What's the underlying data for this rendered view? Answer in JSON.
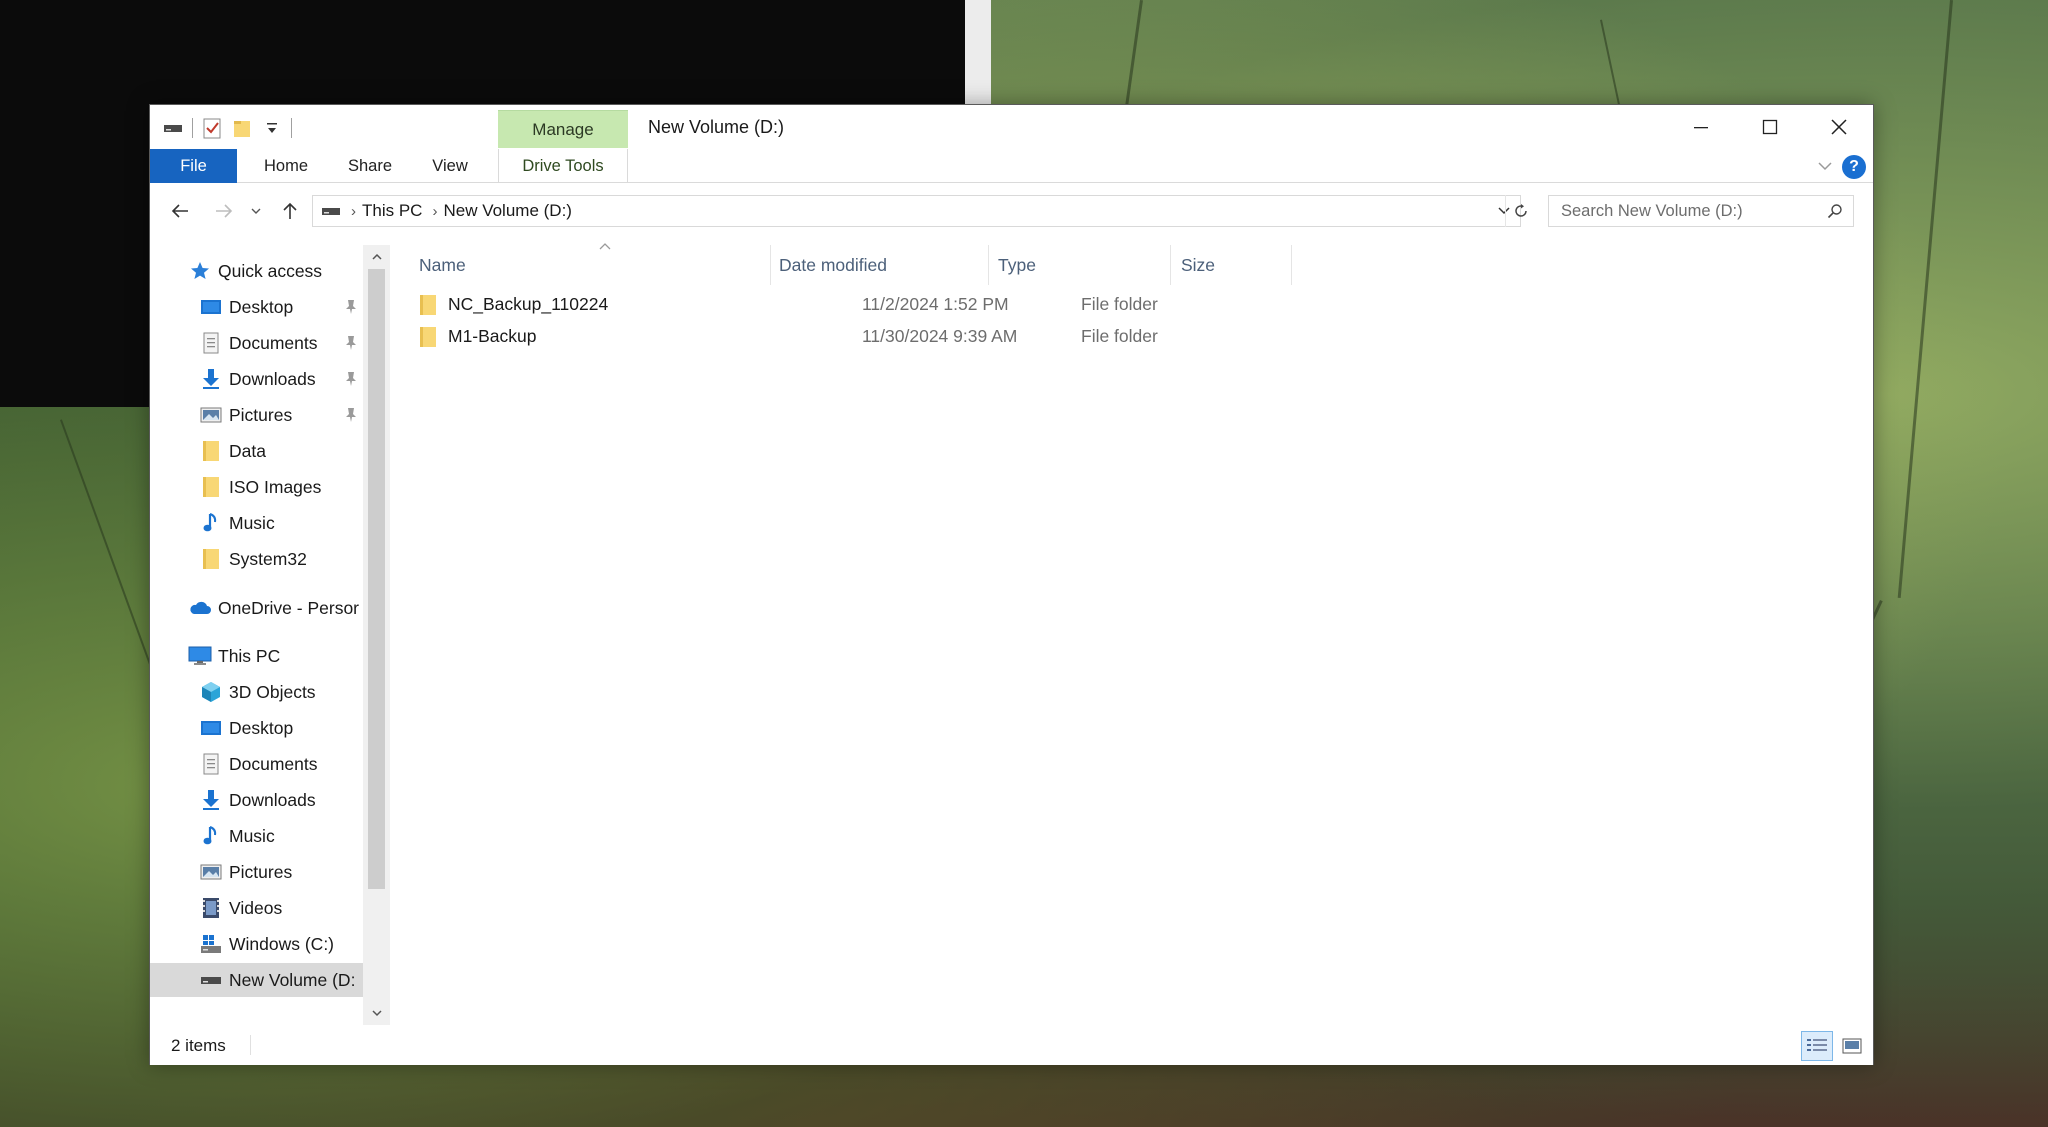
{
  "window": {
    "title": "New Volume (D:)",
    "context_tab_group": "Manage",
    "ribbon_tabs": [
      "File",
      "Home",
      "Share",
      "View",
      "Drive Tools"
    ],
    "help_label": "?"
  },
  "address": {
    "breadcrumbs": [
      "This PC",
      "New Volume (D:)"
    ],
    "search_placeholder": "Search New Volume (D:)"
  },
  "nav_pane": {
    "quick_access": {
      "label": "Quick access",
      "items": [
        {
          "label": "Desktop",
          "icon": "desktop-icon",
          "pinned": true
        },
        {
          "label": "Documents",
          "icon": "documents-icon",
          "pinned": true
        },
        {
          "label": "Downloads",
          "icon": "downloads-icon",
          "pinned": true
        },
        {
          "label": "Pictures",
          "icon": "pictures-icon",
          "pinned": true
        },
        {
          "label": "Data",
          "icon": "folder-icon",
          "pinned": false
        },
        {
          "label": "ISO Images",
          "icon": "folder-icon",
          "pinned": false
        },
        {
          "label": "Music",
          "icon": "music-icon",
          "pinned": false
        },
        {
          "label": "System32",
          "icon": "folder-icon",
          "pinned": false
        }
      ]
    },
    "onedrive": {
      "label": "OneDrive - Persor"
    },
    "this_pc": {
      "label": "This PC",
      "items": [
        {
          "label": "3D Objects",
          "icon": "3d-objects-icon"
        },
        {
          "label": "Desktop",
          "icon": "desktop-icon"
        },
        {
          "label": "Documents",
          "icon": "documents-icon"
        },
        {
          "label": "Downloads",
          "icon": "downloads-icon"
        },
        {
          "label": "Music",
          "icon": "music-icon"
        },
        {
          "label": "Pictures",
          "icon": "pictures-icon"
        },
        {
          "label": "Videos",
          "icon": "videos-icon"
        },
        {
          "label": "Windows (C:)",
          "icon": "windows-drive-icon"
        },
        {
          "label": "New Volume (D:",
          "icon": "drive-icon",
          "selected": true
        }
      ]
    }
  },
  "file_list": {
    "columns": [
      "Name",
      "Date modified",
      "Type",
      "Size"
    ],
    "rows": [
      {
        "name": "NC_Backup_110224",
        "date": "11/2/2024 1:52 PM",
        "type": "File folder",
        "size": ""
      },
      {
        "name": "M1-Backup",
        "date": "11/30/2024 9:39 AM",
        "type": "File folder",
        "size": ""
      }
    ]
  },
  "status": {
    "item_count": "2 items"
  },
  "colors": {
    "accent": "#1764c0",
    "context_tab": "#c7e8b0",
    "folder": "#f8d775",
    "selection": "#d9d9d9"
  }
}
